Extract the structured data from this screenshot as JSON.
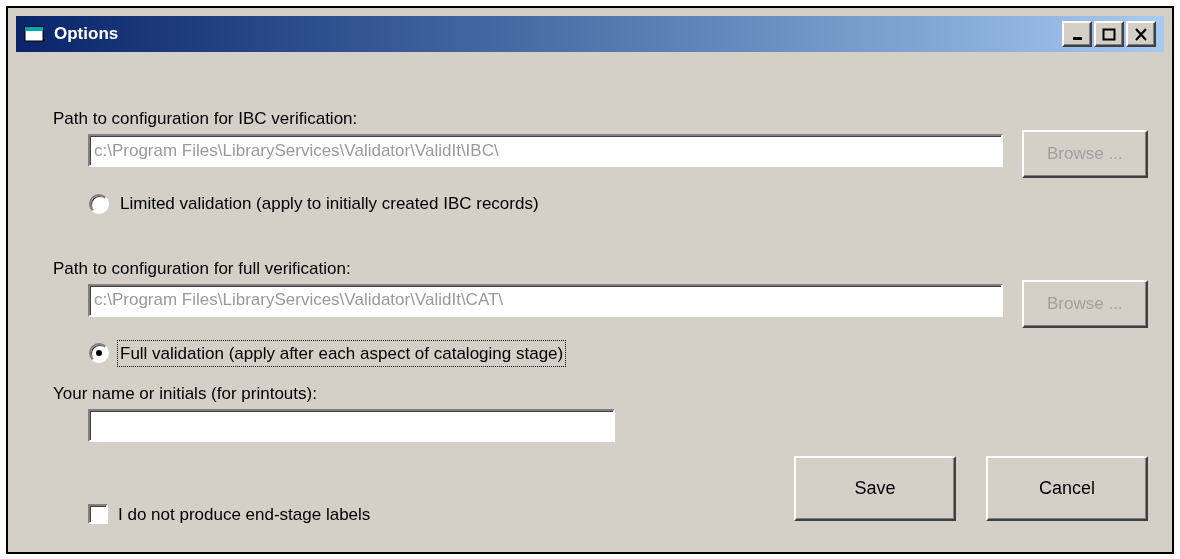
{
  "window": {
    "title": "Options"
  },
  "sections": [
    {
      "label": "Path to configuration for IBC verification:",
      "path": {
        "value": "c:\\Program Files\\LibraryServices\\Validator\\ValidIt\\IBC\\",
        "disabled": true
      },
      "browse": {
        "label": "Browse ...",
        "disabled": true
      },
      "radio": {
        "label": "Limited validation (apply to initially created IBC records)",
        "selected": false,
        "focused": false
      }
    },
    {
      "label": "Path to configuration for full verification:",
      "path": {
        "value": "c:\\Program Files\\LibraryServices\\Validator\\ValidIt\\CAT\\",
        "disabled": true
      },
      "browse": {
        "label": "Browse ...",
        "disabled": true
      },
      "radio": {
        "label": "Full validation (apply after each aspect of cataloging stage)",
        "selected": true,
        "focused": true
      }
    }
  ],
  "name_field": {
    "label": "Your name or initials (for printouts):"
  },
  "checkbox": {
    "label": "I do not produce end-stage labels",
    "checked": false
  },
  "buttons": [
    "Save",
    "Cancel"
  ]
}
